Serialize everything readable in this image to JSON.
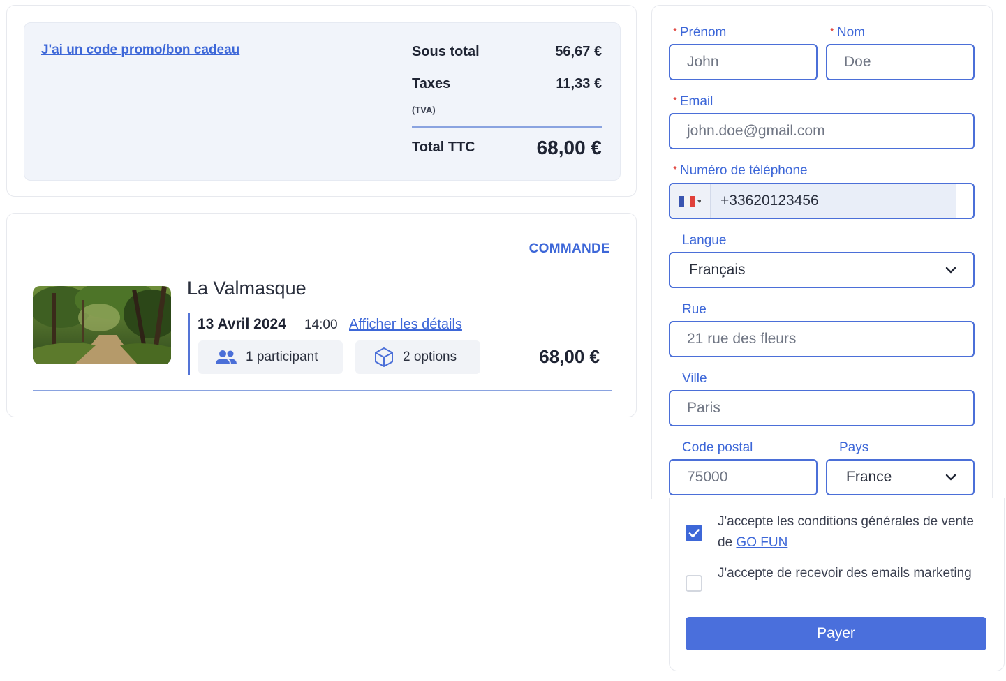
{
  "summary": {
    "promo_link": "J'ai un code promo/bon cadeau",
    "subtotal_label": "Sous total",
    "subtotal_value": "56,67 €",
    "taxes_label": "Taxes",
    "taxes_value": "11,33 €",
    "tva_label": "(TVA)",
    "total_label": "Total TTC",
    "total_value": "68,00 €"
  },
  "order": {
    "section_title": "COMMANDE",
    "product_name": "La Valmasque",
    "date": "13 Avril 2024",
    "time": "14:00",
    "details_link": "Afficher les détails",
    "participants": "1 participant",
    "options": "2 options",
    "price": "68,00 €"
  },
  "form": {
    "required_mark": "*",
    "firstname_label": "Prénom",
    "firstname_placeholder": "John",
    "lastname_label": "Nom",
    "lastname_placeholder": "Doe",
    "email_label": "Email",
    "email_placeholder": "john.doe@gmail.com",
    "phone_label": "Numéro de téléphone",
    "phone_value": "+33620123456",
    "language_label": "Langue",
    "language_value": "Français",
    "street_label": "Rue",
    "street_placeholder": "21 rue des fleurs",
    "city_label": "Ville",
    "city_placeholder": "Paris",
    "postal_label": "Code postal",
    "postal_placeholder": "75000",
    "country_label": "Pays",
    "country_value": "France"
  },
  "consent": {
    "cgv_text": "J'accepte les conditions générales de vente de ",
    "cgv_link": "GO FUN",
    "cgv_checked": true,
    "marketing_text": "J'accepte de recevoir des emails marketing",
    "marketing_checked": false
  },
  "pay_button": "Payer",
  "colors": {
    "accent": "#3d67d8",
    "button": "#4a6fdc",
    "required": "#e0403a",
    "summary_bg": "#f1f4fa"
  },
  "icons": {
    "participants": "people-icon",
    "options": "cube-icon",
    "select": "chevron-down-icon",
    "flag": "france-flag-icon",
    "check": "check-icon"
  }
}
